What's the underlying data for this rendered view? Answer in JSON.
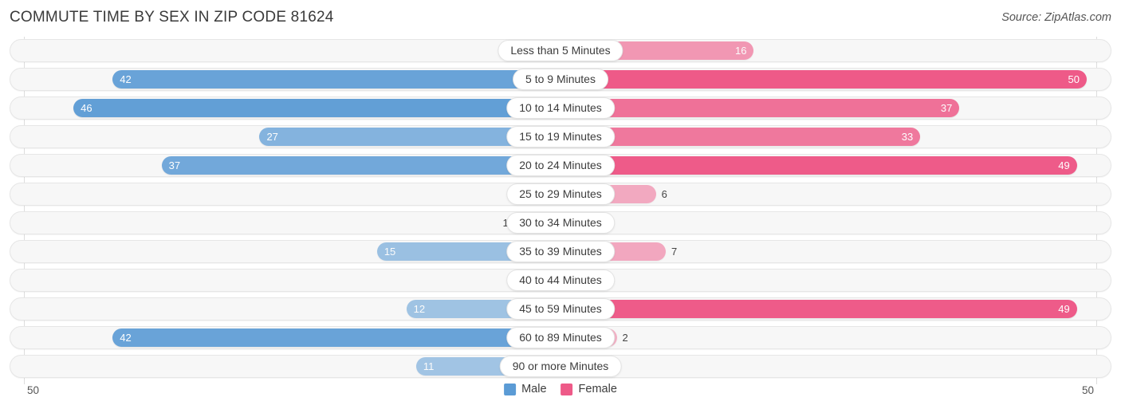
{
  "header": {
    "title": "COMMUTE TIME BY SEX IN ZIP CODE 81624",
    "source": "Source: ZipAtlas.com"
  },
  "legend": {
    "male_label": "Male",
    "female_label": "Female",
    "male_color": "#5b9bd5",
    "female_color": "#ee5a88"
  },
  "axis": {
    "left_max": "50",
    "right_max": "50"
  },
  "chart_data": {
    "type": "bar",
    "subtype": "diverging-bidirectional-bar",
    "title": "COMMUTE TIME BY SEX IN ZIP CODE 81624",
    "xlabel": "",
    "ylabel": "",
    "xlim": [
      50,
      50
    ],
    "axis_max": 50,
    "grid": true,
    "legend_position": "bottom-center",
    "categories": [
      "Less than 5 Minutes",
      "5 to 9 Minutes",
      "10 to 14 Minutes",
      "15 to 19 Minutes",
      "20 to 24 Minutes",
      "25 to 29 Minutes",
      "30 to 34 Minutes",
      "35 to 39 Minutes",
      "40 to 44 Minutes",
      "45 to 59 Minutes",
      "60 to 89 Minutes",
      "90 or more Minutes"
    ],
    "series": [
      {
        "name": "Male",
        "direction": "left",
        "color": "#5b9bd5",
        "values": [
          1,
          42,
          46,
          27,
          37,
          0,
          1,
          15,
          0,
          12,
          42,
          11
        ]
      },
      {
        "name": "Female",
        "direction": "right",
        "color": "#ee5a88",
        "values": [
          16,
          50,
          37,
          33,
          49,
          6,
          0,
          7,
          0,
          49,
          2,
          0
        ]
      }
    ]
  }
}
